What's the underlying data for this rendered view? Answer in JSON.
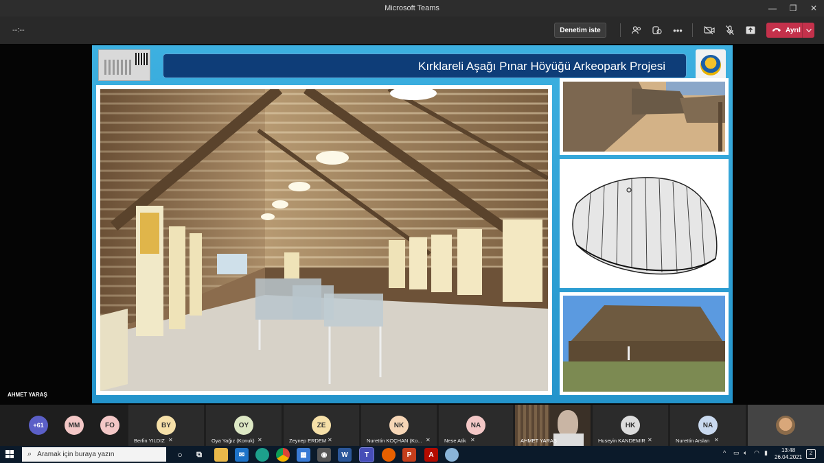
{
  "window": {
    "title": "Microsoft Teams",
    "minimize": "—",
    "restore": "❐",
    "close": "✕"
  },
  "toolbar": {
    "timer": "--:--",
    "request_control": "Denetim iste",
    "leave_label": "Ayrıl",
    "icons": [
      "people-icon",
      "reactions-icon",
      "more-icon",
      "camera-off-icon",
      "mic-off-icon",
      "share-icon"
    ]
  },
  "slide": {
    "title": "Kırklareli Aşağı Pınar Höyüğü Arkeopark Projesi"
  },
  "presenter_tag": "AHMET YARAŞ",
  "participants": {
    "overflow": "+61",
    "tiles": [
      {
        "initials": "MM",
        "color": "#f3c7c6"
      },
      {
        "initials": "FO",
        "color": "#f3c7c6"
      },
      {
        "initials": "BY",
        "name": "Berfin YILDIZ",
        "color": "#f6e0a8"
      },
      {
        "initials": "OY",
        "name": "Oya Yağız (Konuk)",
        "color": "#dde8c4"
      },
      {
        "initials": "ZE",
        "name": "Zeynep ERDEM",
        "color": "#f6e0a8"
      },
      {
        "initials": "NK",
        "name": "Nurettin KOÇHAN (Ko...",
        "color": "#f6d6b6"
      },
      {
        "initials": "NA",
        "name": "Nese Atik",
        "color": "#f3c7c6"
      },
      {
        "name": "AHMET YARAŞ"
      },
      {
        "initials": "HK",
        "name": "Huseyin KANDEMIR",
        "color": "#dcdcdc"
      },
      {
        "initials": "NA",
        "name": "Nurettin Arslan",
        "color": "#c9d9ef"
      }
    ]
  },
  "taskbar": {
    "search_placeholder": "Aramak için buraya yazın",
    "time": "13:48",
    "date": "26.04.2021",
    "notification_count": "2"
  }
}
